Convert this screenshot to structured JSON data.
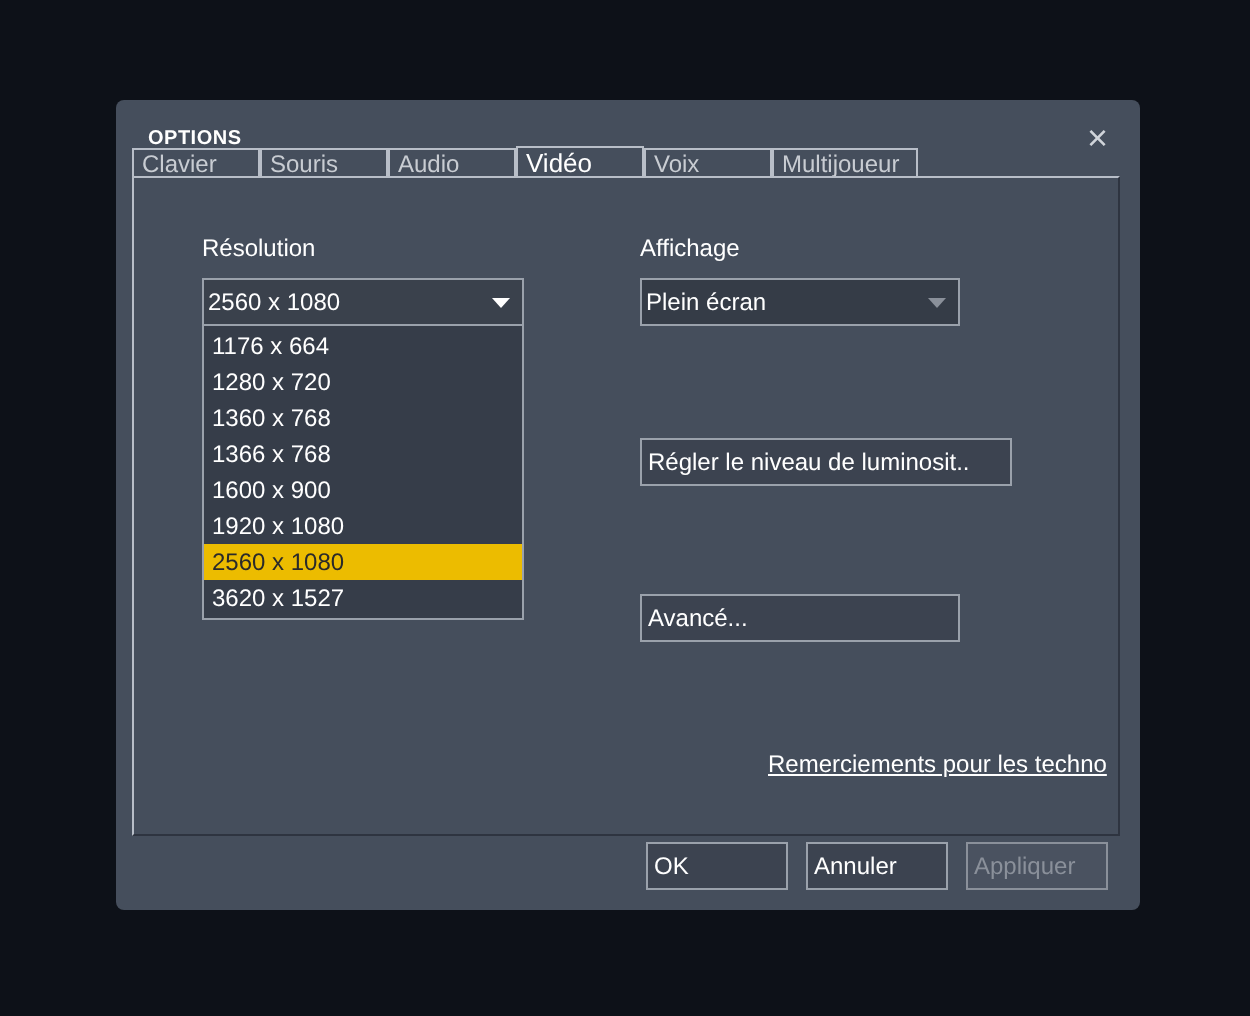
{
  "window": {
    "title": "OPTIONS",
    "close": "×"
  },
  "tabs": [
    {
      "label": "Clavier",
      "selected": false
    },
    {
      "label": "Souris",
      "selected": false
    },
    {
      "label": "Audio",
      "selected": false
    },
    {
      "label": "Vidéo",
      "selected": true
    },
    {
      "label": "Voix",
      "selected": false
    },
    {
      "label": "Multijoueur",
      "selected": false
    }
  ],
  "resolution": {
    "label": "Résolution",
    "value": "2560 x 1080",
    "expanded": true,
    "options": [
      {
        "label": "1176 x 664",
        "selected": false
      },
      {
        "label": "1280 x 720",
        "selected": false
      },
      {
        "label": "1360 x 768",
        "selected": false
      },
      {
        "label": "1366 x 768",
        "selected": false
      },
      {
        "label": "1600 x 900",
        "selected": false
      },
      {
        "label": "1920 x 1080",
        "selected": false
      },
      {
        "label": "2560 x 1080",
        "selected": true
      },
      {
        "label": "3620 x 1527",
        "selected": false
      }
    ]
  },
  "display": {
    "label": "Affichage",
    "value": "Plein écran"
  },
  "brightness_button": "Régler le niveau de luminosit..",
  "advanced_button": "Avancé...",
  "credits_link": "Remerciements pour les techno",
  "footer_buttons": [
    {
      "label": "OK",
      "disabled": false
    },
    {
      "label": "Annuler",
      "disabled": false
    },
    {
      "label": "Appliquer",
      "disabled": true
    }
  ]
}
